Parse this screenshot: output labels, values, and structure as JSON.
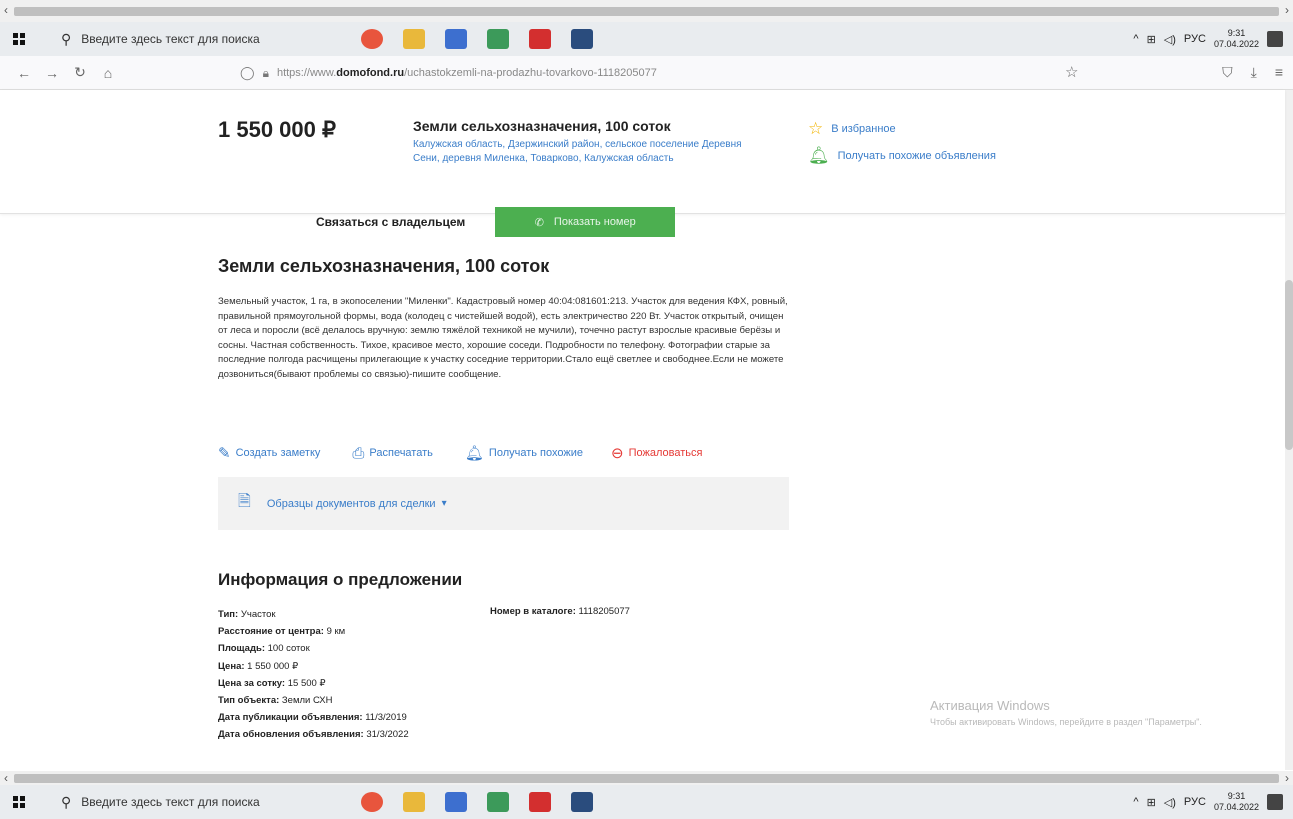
{
  "taskbar": {
    "search_placeholder": "Введите здесь текст для поиска",
    "tray_lang": "РУС",
    "clock_time": "9:31",
    "clock_date": "07.04.2022",
    "apps": [
      {
        "icon": "firefox-icon",
        "color": "#e8553d"
      },
      {
        "icon": "file-explorer-icon",
        "color": "#e9b83b"
      },
      {
        "icon": "word-icon",
        "color": "#3d6fcf"
      },
      {
        "icon": "excel-icon",
        "color": "#3c9a5a"
      },
      {
        "icon": "acrobat-icon",
        "color": "#d32f2f"
      },
      {
        "icon": "media-app-icon",
        "color": "#2a4c7d"
      }
    ]
  },
  "browser": {
    "url_prefix": "https://www.",
    "url_domain": "domofond.ru",
    "url_path": "/uchastokzemli-na-prodazhu-tovarkovo-1118205077"
  },
  "listing": {
    "price": "1 550 000 ₽",
    "title": "Земли сельхозназначения, 100 соток",
    "address": "Калужская область, Дзержинский район, сельское поселение Деревня Сени, деревня Миленка, Товарково, Калужская область",
    "favorites": "В избранное",
    "similar_alerts": "Получать похожие объявления"
  },
  "contact": {
    "label": "Связаться с владельцем",
    "show_phone": "Показать номер"
  },
  "main": {
    "title": "Земли сельхозназначения, 100 соток",
    "description": "Земельный участок, 1 га, в экопоселении \"Миленки\". Кадастровый номер 40:04:081601:213. Участок для ведения КФХ, ровный, правильной прямоугольной формы, вода (колодец с чистейшей водой), есть электричество 220 Вт. Участок открытый, очищен от леса и поросли (всё делалось вручную: землю тяжёлой техникой не мучили), точечно растут взрослые красивые берёзы и сосны. Частная собственность. Тихое, красивое место, хорошие соседи. Подробности по телефону. Фотографии старые за последние полгода расчищены прилегающие к участку соседние территории.Стало ещё светлее и свободнее.Если не можете дозвониться(бывают проблемы со связью)-пишите сообщение."
  },
  "actions": {
    "note": "Создать заметку",
    "print": "Распечатать",
    "similar": "Получать похожие",
    "report": "Пожаловаться"
  },
  "docs": {
    "label": "Образцы документов для сделки"
  },
  "info": {
    "title": "Информация о предложении",
    "rows": [
      {
        "key": "Тип:",
        "value": "Участок"
      },
      {
        "key": "Расстояние от центра:",
        "value": "9 км"
      },
      {
        "key": "Площадь:",
        "value": "100 соток"
      },
      {
        "key": "Цена:",
        "value": "1 550 000 ₽"
      },
      {
        "key": "Цена за сотку:",
        "value": "15 500 ₽"
      },
      {
        "key": "Тип объекта:",
        "value": "Земли СХН"
      },
      {
        "key": "Дата публикации объявления:",
        "value": "11/3/2019"
      },
      {
        "key": "Дата обновления объявления:",
        "value": "31/3/2022"
      }
    ],
    "catalog_key": "Номер в каталоге:",
    "catalog_value": "1118205077"
  },
  "watermark": {
    "line1": "Активация Windows",
    "line2": "Чтобы активировать Windows, перейдите в раздел \"Параметры\"."
  }
}
